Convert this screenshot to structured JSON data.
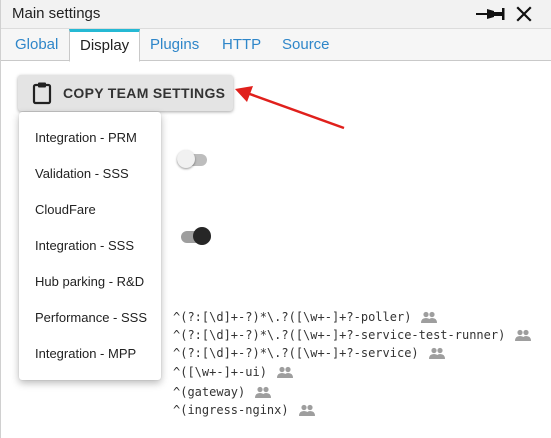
{
  "window": {
    "title": "Main settings",
    "icons": [
      "pin-icon",
      "close-icon"
    ]
  },
  "tabs": [
    {
      "label": "Global",
      "active": false
    },
    {
      "label": "Display",
      "active": true
    },
    {
      "label": "Plugins",
      "active": false
    },
    {
      "label": "HTTP",
      "active": false
    },
    {
      "label": "Source",
      "active": false
    }
  ],
  "copy_button": {
    "label": "COPY TEAM SETTINGS",
    "icon": "clipboard-icon"
  },
  "dropdown_menu": {
    "items": [
      "Integration - PRM",
      "Validation - SSS",
      "CloudFare",
      "Integration - SSS",
      "Hub parking - R&D",
      "Performance - SSS",
      "Integration - MPP"
    ]
  },
  "toggles": [
    {
      "state": "off"
    },
    {
      "state": "on"
    }
  ],
  "patterns": [
    "^(?:[\\d]+-?)*\\.?([\\w+-]+?-poller)",
    "^(?:[\\d]+-?)*\\.?([\\w+-]+?-service-test-runner)",
    "^(?:[\\d]+-?)*\\.?([\\w+-]+?-service)",
    "^([\\w+-]+-ui)",
    "^(gateway)",
    "^(ingress-nginx)"
  ],
  "colors": {
    "active_tab_accent": "#25b9d4",
    "tab_link": "#2e86c9",
    "annotation_arrow": "#e0201c"
  }
}
